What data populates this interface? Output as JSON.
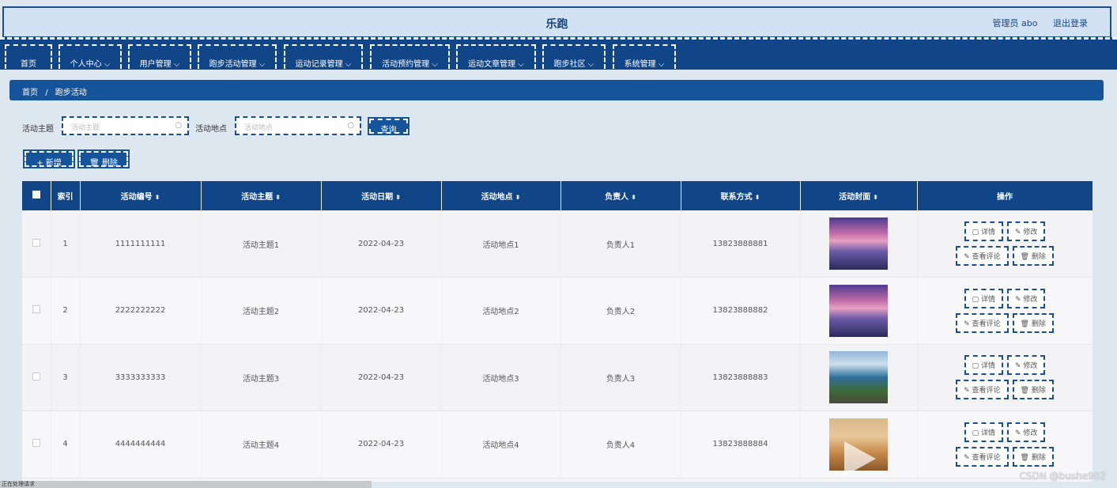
{
  "header": {
    "title": "乐跑",
    "admin_label": "管理员 abo",
    "logout": "退出登录"
  },
  "nav": [
    "首页",
    "个人中心 ⌵",
    "用户管理 ⌵",
    "跑步活动管理 ⌵",
    "运动记录管理 ⌵",
    "活动预约管理 ⌵",
    "运动文章管理 ⌵",
    "跑步社区 ⌵",
    "系统管理 ⌵"
  ],
  "breadcrumb": {
    "home": "首页",
    "sep": "/",
    "current": "跑步活动"
  },
  "search": {
    "theme_label": "活动主题",
    "theme_placeholder": "活动主题",
    "place_label": "活动地点",
    "place_placeholder": "活动地点",
    "query_button": "查询"
  },
  "actions": {
    "add": "+ 新增",
    "delete": "🗑 删除"
  },
  "table": {
    "headers": [
      "索引",
      "活动编号",
      "活动主题",
      "活动日期",
      "活动地点",
      "负责人",
      "联系方式",
      "活动封面",
      "操作"
    ],
    "rows": [
      {
        "idx": "1",
        "code": "1111111111",
        "theme": "活动主题1",
        "date": "2022-04-23",
        "place": "活动地点1",
        "owner": "负责人1",
        "phone": "13823888881",
        "cover": "purple-sunset"
      },
      {
        "idx": "2",
        "code": "2222222222",
        "theme": "活动主题2",
        "date": "2022-04-23",
        "place": "活动地点2",
        "owner": "负责人2",
        "phone": "13823888882",
        "cover": "purple-sunset"
      },
      {
        "idx": "3",
        "code": "3333333333",
        "theme": "活动主题3",
        "date": "2022-04-23",
        "place": "活动地点3",
        "owner": "负责人3",
        "phone": "13823888883",
        "cover": "lake-island"
      },
      {
        "idx": "4",
        "code": "4444444444",
        "theme": "活动主题4",
        "date": "2022-04-23",
        "place": "活动地点4",
        "owner": "负责人4",
        "phone": "13823888884",
        "cover": "desert-dunes"
      }
    ],
    "ops": {
      "detail": "▢ 详情",
      "edit": "✎ 修改",
      "comments": "✎ 查看评论",
      "remove": "🗑 删除"
    }
  },
  "statusbar": "正在处理请求",
  "watermark": "CSDN @bushe902",
  "colors": {
    "primary": "#104587",
    "header_bg": "#d3e2f2",
    "page_bg": "#dde7f0"
  }
}
